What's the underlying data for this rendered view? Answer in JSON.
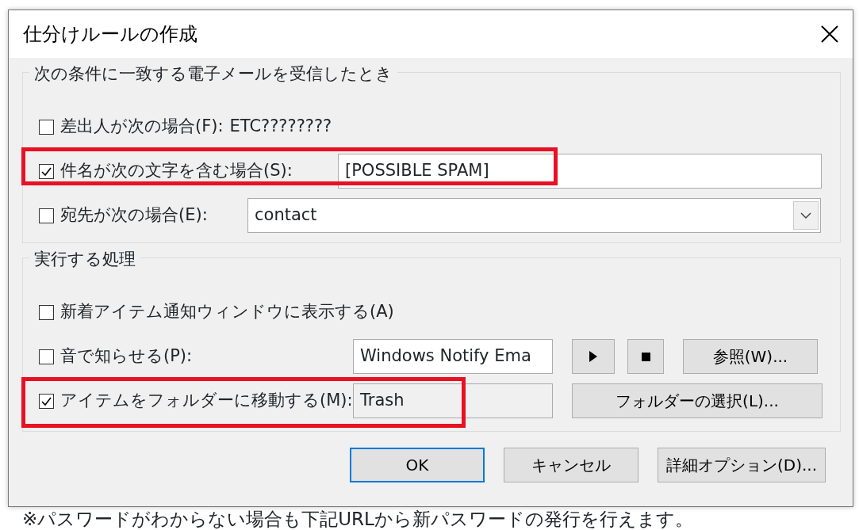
{
  "window": {
    "title": "仕分けルールの作成"
  },
  "conditions": {
    "title": "次の条件に一致する電子メールを受信したとき",
    "rows": [
      {
        "kind": "text",
        "checked": false,
        "label": "差出人が次の場合(F):",
        "value": "ETC????????",
        "highlighted": false
      },
      {
        "kind": "textbox",
        "checked": true,
        "label": "件名が次の文字を含む場合(S):",
        "value": "[POSSIBLE SPAM]",
        "highlighted": true
      },
      {
        "kind": "combo",
        "checked": false,
        "label": "宛先が次の場合(E):",
        "value": "contact",
        "highlighted": false
      }
    ]
  },
  "actions": {
    "title": "実行する処理",
    "rows": [
      {
        "kind": "plain",
        "checked": false,
        "label": "新着アイテム通知ウィンドウに表示する(A)",
        "highlighted": false
      },
      {
        "kind": "sound",
        "checked": false,
        "label": "音で知らせる(P):",
        "value": "Windows Notify Ema",
        "button": "参照(W)...",
        "highlighted": false
      },
      {
        "kind": "folder",
        "checked": true,
        "label": "アイテムをフォルダーに移動する(M):",
        "value": "Trash",
        "button": "フォルダーの選択(L)...",
        "highlighted": true
      }
    ]
  },
  "buttons": [
    {
      "label": "OK",
      "default": true
    },
    {
      "label": "キャンセル",
      "default": false
    },
    {
      "label": "詳細オプション(D)...",
      "default": false
    }
  ],
  "background_text": "※パスワードがわからない場合も下記URLから新パスワードの発行を行えます。"
}
